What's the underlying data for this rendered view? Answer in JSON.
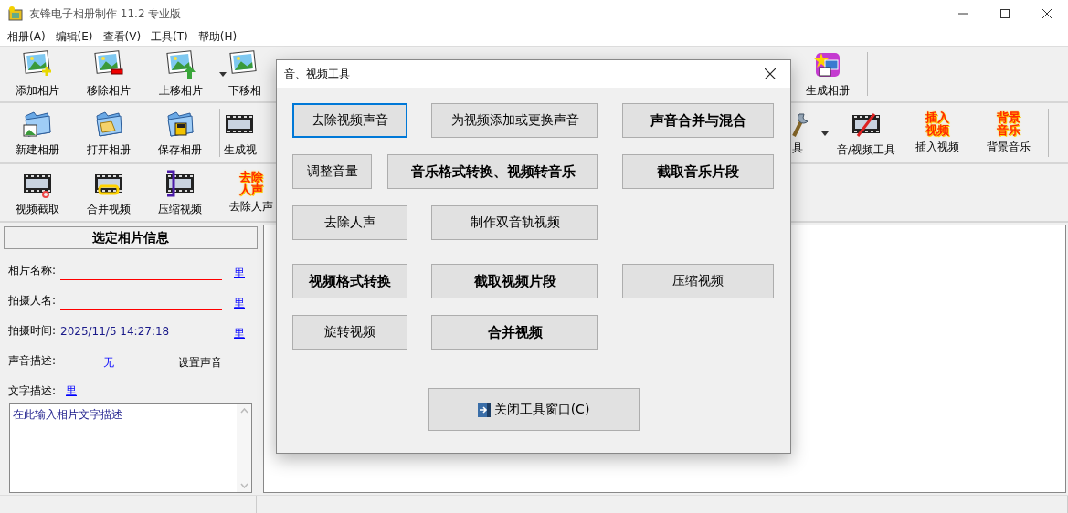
{
  "window": {
    "title": "友锋电子相册制作 11.2 专业版"
  },
  "menu": [
    {
      "label": "相册(A)"
    },
    {
      "label": "编辑(E)"
    },
    {
      "label": "查看(V)"
    },
    {
      "label": "工具(T)"
    },
    {
      "label": "帮助(H)"
    }
  ],
  "toolbars": [
    {
      "left": [
        {
          "label": "添加相片",
          "dropdown": false
        },
        {
          "label": "移除相片",
          "dropdown": false
        },
        {
          "label": "上移相片",
          "dropdown": true
        },
        {
          "label": "下移相",
          "dropdown": false
        }
      ],
      "right": [
        {
          "label": "生成相册",
          "dropdown": false
        }
      ]
    },
    {
      "left": [
        {
          "label": "新建相册",
          "dropdown": false
        },
        {
          "label": "打开相册",
          "dropdown": false
        },
        {
          "label": "保存相册",
          "dropdown": false
        },
        {
          "label": "生成视",
          "dropdown": false
        }
      ],
      "right": [
        {
          "label": "具",
          "dropdown": true
        },
        {
          "label": "音/视频工具",
          "dropdown": false
        },
        {
          "label": "插入视频",
          "dropdown": false,
          "icon_text": [
            "插入",
            "视频"
          ]
        },
        {
          "label": "背景音乐",
          "dropdown": false,
          "icon_text": [
            "背景",
            "音乐"
          ]
        }
      ]
    },
    {
      "left": [
        {
          "label": "视频截取",
          "dropdown": false
        },
        {
          "label": "合并视频",
          "dropdown": false
        },
        {
          "label": "压缩视频",
          "dropdown": false
        },
        {
          "label": "去除人声",
          "dropdown": false,
          "icon_text": [
            "去除",
            "人声"
          ]
        }
      ]
    }
  ],
  "photo_info": {
    "header": "选定相片信息",
    "fields": [
      {
        "label": "相片名称:",
        "link": "里"
      },
      {
        "label": "拍摄人名:",
        "link": "里"
      },
      {
        "label": "拍摄时间:",
        "value": "2025/11/5 14:27:18",
        "link": "里"
      }
    ],
    "sound": {
      "label": "声音描述:",
      "value": "无",
      "action": "设置声音"
    },
    "text": {
      "label": "文字描述:",
      "link": "里",
      "value": "在此输入相片文字描述"
    }
  },
  "dialog": {
    "title": "音、视频工具",
    "rows": [
      [
        {
          "label": "去除视频声音",
          "bold": false,
          "focused": true
        },
        {
          "label": "为视频添加或更换声音",
          "bold": false,
          "focused": false
        },
        {
          "label": "声音合并与混合",
          "bold": true,
          "focused": false
        }
      ],
      [
        {
          "label": "调整音量",
          "bold": false,
          "focused": false
        },
        {
          "label": "音乐格式转换、视频转音乐",
          "bold": true,
          "focused": false
        },
        {
          "label": "截取音乐片段",
          "bold": true,
          "focused": false
        }
      ],
      [
        {
          "label": "去除人声",
          "bold": false,
          "focused": false
        },
        {
          "label": "制作双音轨视频",
          "bold": false,
          "focused": false
        }
      ],
      [
        {
          "label": "视频格式转换",
          "bold": true,
          "focused": false
        },
        {
          "label": "截取视频片段",
          "bold": true,
          "focused": false
        },
        {
          "label": "压缩视频",
          "bold": false,
          "focused": false
        }
      ],
      [
        {
          "label": "旋转视频",
          "bold": false,
          "focused": false
        },
        {
          "label": "合并视频",
          "bold": true,
          "focused": false
        }
      ]
    ],
    "close_button": "关闭工具窗口(C)"
  }
}
